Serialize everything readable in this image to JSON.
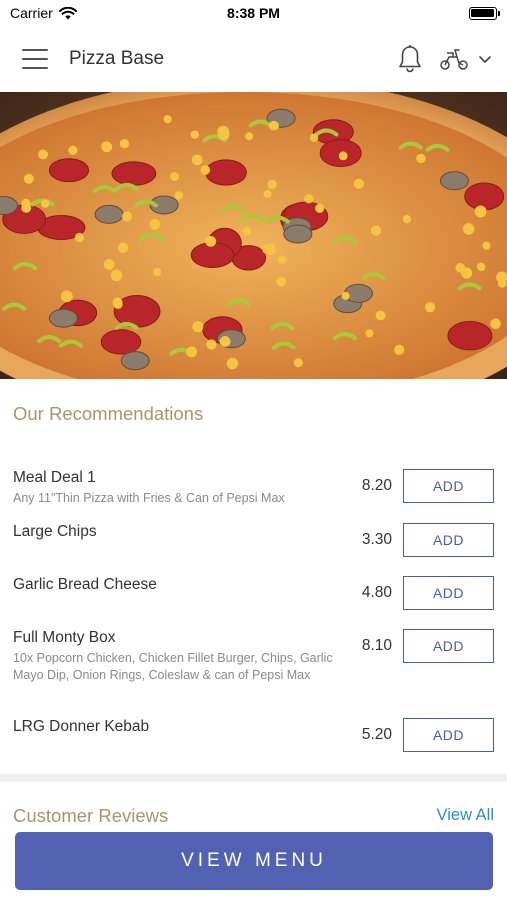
{
  "status_bar": {
    "carrier": "Carrier",
    "time": "8:38 PM",
    "battery_level": 1.0
  },
  "nav": {
    "title": "Pizza Base",
    "icons": [
      "menu-icon",
      "bell-icon",
      "scooter-icon",
      "chevron-down-icon"
    ]
  },
  "hero": {
    "image": "pizza-photo"
  },
  "recommendations": {
    "title": "Our Recommendations",
    "items": [
      {
        "name": "Meal Deal 1",
        "description": "Any 11\"Thin Pizza with Fries & Can of Pepsi Max",
        "price": "8.20",
        "button": "ADD"
      },
      {
        "name": "Large Chips",
        "description": "",
        "price": "3.30",
        "button": "ADD"
      },
      {
        "name": "Garlic Bread Cheese",
        "description": "",
        "price": "4.80",
        "button": "ADD"
      },
      {
        "name": "Full Monty Box",
        "description": "10x Popcorn Chicken, Chicken Fillet Burger, Chips, Garlic Mayo Dip, Onion Rings, Coleslaw & can of Pepsi Max",
        "price": "8.10",
        "button": "ADD"
      },
      {
        "name": "LRG Donner Kebab",
        "description": "",
        "price": "5.20",
        "button": "ADD"
      }
    ]
  },
  "reviews": {
    "title": "Customer Reviews",
    "view_all": "View All"
  },
  "footer": {
    "button": "VIEW MENU"
  },
  "colors": {
    "accent": "#5361b3",
    "section_title": "#a8956e",
    "link": "#2f8fc4"
  }
}
